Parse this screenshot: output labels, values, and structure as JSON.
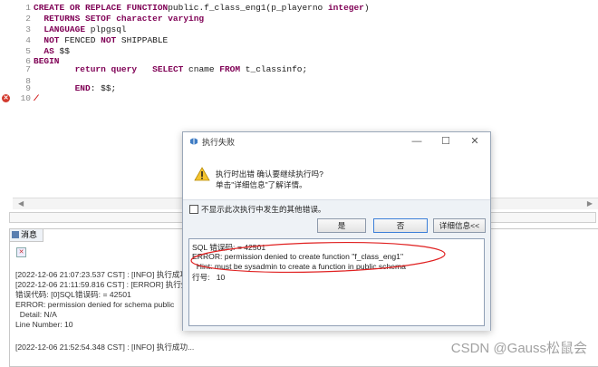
{
  "editor": {
    "lines": [
      {
        "n": "1",
        "parts": [
          [
            "kw",
            "CREATE OR REPLACE FUNCTION"
          ],
          [
            "",
            "public.f_class_eng1(p_playerno "
          ],
          [
            "kw",
            "integer"
          ],
          [
            "",
            ")"
          ]
        ]
      },
      {
        "n": "2",
        "parts": [
          [
            "",
            "  "
          ],
          [
            "kw",
            "RETURNS SETOF character varying"
          ]
        ]
      },
      {
        "n": "3",
        "parts": [
          [
            "",
            "  "
          ],
          [
            "kw",
            "LANGUAGE"
          ],
          [
            "",
            " plpgsql"
          ]
        ]
      },
      {
        "n": "4",
        "parts": [
          [
            "",
            "  "
          ],
          [
            "kw",
            "NOT"
          ],
          [
            "",
            " FENCED "
          ],
          [
            "kw",
            "NOT"
          ],
          [
            "",
            " SHIPPABLE"
          ]
        ]
      },
      {
        "n": "5",
        "parts": [
          [
            "",
            "  "
          ],
          [
            "kw",
            "AS"
          ],
          [
            "",
            " $$"
          ]
        ]
      },
      {
        "n": "6",
        "parts": [
          [
            "kw",
            "BEGIN"
          ]
        ]
      },
      {
        "n": "7",
        "parts": [
          [
            "",
            "        "
          ],
          [
            "kw",
            "return query"
          ],
          [
            "",
            "   "
          ],
          [
            "kw",
            "SELECT"
          ],
          [
            "",
            " cname "
          ],
          [
            "kw",
            "FROM"
          ],
          [
            "",
            " t_classinfo;"
          ]
        ]
      },
      {
        "n": "8",
        "parts": []
      },
      {
        "n": "9",
        "parts": [
          [
            "",
            "        "
          ],
          [
            "kw",
            "END"
          ],
          [
            "",
            ": $$;"
          ]
        ]
      },
      {
        "n": "10",
        "parts": [
          [
            "squiggle",
            "/"
          ]
        ]
      }
    ]
  },
  "messages": {
    "tab_label": "消息",
    "log_lines": [
      "[2022-12-06 21:07:23.537 CST] : [INFO] 执行成功...",
      "[2022-12-06 21:11:59.816 CST] : [ERROR] 执行失败",
      "错误代码: [0]SQL错误码: = 42501",
      "ERROR: permission denied for schema public",
      "  Detail: N/A",
      "Line Number: 10",
      "",
      "[2022-12-06 21:52:54.348 CST] : [INFO] 执行成功..."
    ]
  },
  "dialog": {
    "title": "执行失败",
    "minimize": "—",
    "maximize": "☐",
    "close": "✕",
    "question": "执行时出错 确认要继续执行吗?",
    "hint": "单击\"详细信息\"了解详情。",
    "checkbox_label": "不显示此次执行中发生的其他错误。",
    "yes_label": "是",
    "no_label": "否",
    "details_label": "详细信息<<",
    "details": [
      "SQL 错误码: = 42501",
      "ERROR: permission denied to create function \"f_class_eng1\"",
      "  Hint: must be sysadmin to create a function in public schema",
      "行号:   10"
    ]
  },
  "watermark": "CSDN @Gauss松鼠会",
  "colors": {
    "keyword": "#7f0055",
    "annotation": "#e02020",
    "error_mark": "#d23a2e"
  }
}
